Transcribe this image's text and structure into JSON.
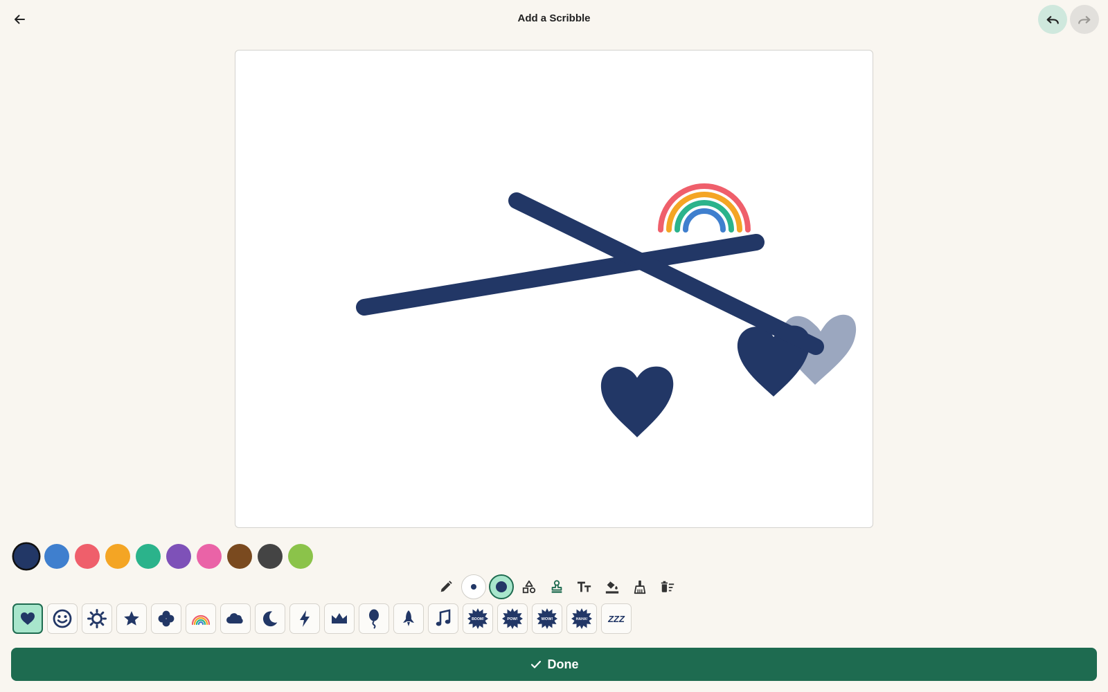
{
  "header": {
    "title": "Add a Scribble",
    "back_icon": "arrow-left-icon",
    "undo_icon": "undo-icon",
    "redo_icon": "redo-icon"
  },
  "canvas": {
    "background": "#ffffff",
    "ink_color": "#223766",
    "elements": [
      "line-stroke",
      "line-stroke",
      "rainbow-sticker",
      "heart-sticker",
      "heart-sticker",
      "heart-sticker-faded"
    ]
  },
  "palette": {
    "selected": "navy",
    "colors": [
      {
        "name": "navy",
        "hex": "#223766"
      },
      {
        "name": "blue",
        "hex": "#3f7fce"
      },
      {
        "name": "red",
        "hex": "#ef5f6b"
      },
      {
        "name": "orange",
        "hex": "#f4a524"
      },
      {
        "name": "green",
        "hex": "#2bb38b"
      },
      {
        "name": "purple",
        "hex": "#7e51b8"
      },
      {
        "name": "pink",
        "hex": "#ea63a7"
      },
      {
        "name": "brown",
        "hex": "#7a4a1f"
      },
      {
        "name": "dark-gray",
        "hex": "#444444"
      },
      {
        "name": "lime",
        "hex": "#8bc34a"
      }
    ]
  },
  "tools": [
    {
      "name": "pencil",
      "icon": "pencil-icon"
    },
    {
      "name": "brush-size-small",
      "icon": "small-dot-icon"
    },
    {
      "name": "brush-size-large",
      "icon": "large-dot-icon",
      "active": true
    },
    {
      "name": "shapes",
      "icon": "shapes-icon"
    },
    {
      "name": "stamp",
      "icon": "stamp-icon"
    },
    {
      "name": "text",
      "icon": "text-size-icon"
    },
    {
      "name": "fill",
      "icon": "paint-bucket-icon"
    },
    {
      "name": "eraser",
      "icon": "broom-icon"
    },
    {
      "name": "clear",
      "icon": "delete-sweep-icon"
    }
  ],
  "stickers": {
    "selected": "heart",
    "items": [
      {
        "name": "heart",
        "icon": "heart-icon"
      },
      {
        "name": "smiley",
        "icon": "smiley-icon"
      },
      {
        "name": "sun",
        "icon": "sun-icon"
      },
      {
        "name": "star",
        "icon": "star-icon"
      },
      {
        "name": "flower",
        "icon": "flower-icon"
      },
      {
        "name": "rainbow",
        "icon": "rainbow-icon"
      },
      {
        "name": "cloud",
        "icon": "cloud-icon"
      },
      {
        "name": "moon",
        "icon": "moon-icon"
      },
      {
        "name": "lightning",
        "icon": "lightning-icon"
      },
      {
        "name": "crown",
        "icon": "crown-icon"
      },
      {
        "name": "balloon",
        "icon": "balloon-icon"
      },
      {
        "name": "rocket",
        "icon": "rocket-icon"
      },
      {
        "name": "music",
        "icon": "music-note-icon"
      },
      {
        "name": "boom",
        "icon": "burst-icon",
        "label": "BOOM!"
      },
      {
        "name": "pow",
        "icon": "burst-icon",
        "label": "POW!"
      },
      {
        "name": "wow",
        "icon": "burst-icon",
        "label": "WOW!"
      },
      {
        "name": "haha",
        "icon": "burst-icon",
        "label": "HAHA!"
      },
      {
        "name": "zzz",
        "icon": "zzz-icon",
        "label": "ZZZ"
      }
    ]
  },
  "footer": {
    "done_label": "Done",
    "done_icon": "check-icon"
  }
}
